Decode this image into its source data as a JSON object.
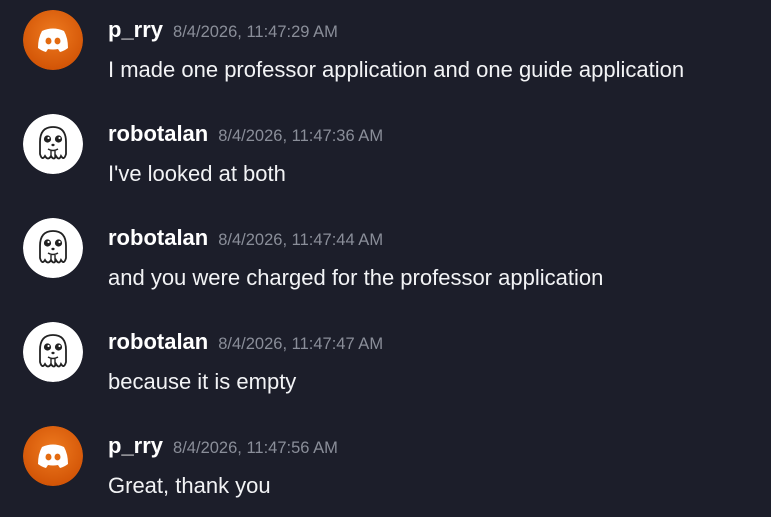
{
  "messages": [
    {
      "author": "p_rry",
      "avatar_icon": "discord-logo-icon",
      "timestamp": "8/4/2026, 11:47:29 AM",
      "text": "I made one professor application and one guide application"
    },
    {
      "author": "robotalan",
      "avatar_icon": "ghost-robot-icon",
      "timestamp": "8/4/2026, 11:47:36 AM",
      "text": "I've looked at both"
    },
    {
      "author": "robotalan",
      "avatar_icon": "ghost-robot-icon",
      "timestamp": "8/4/2026, 11:47:44 AM",
      "text": "and you were charged for the professor application"
    },
    {
      "author": "robotalan",
      "avatar_icon": "ghost-robot-icon",
      "timestamp": "8/4/2026, 11:47:47 AM",
      "text": "because it is empty"
    },
    {
      "author": "p_rry",
      "avatar_icon": "discord-logo-icon",
      "timestamp": "8/4/2026, 11:47:56 AM",
      "text": "Great, thank you"
    }
  ],
  "colors": {
    "background": "#1c1e2a",
    "discord_avatar_bg": "#e8650f",
    "timestamp": "#8a8e99",
    "text": "#f2f3f5"
  }
}
